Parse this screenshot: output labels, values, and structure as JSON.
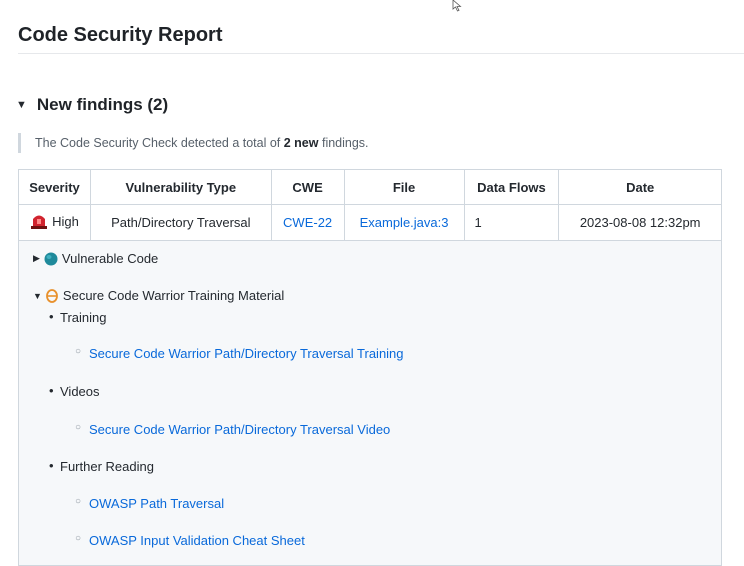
{
  "report": {
    "title": "Code Security Report",
    "section_title": "New findings (2)",
    "summary": {
      "prefix": "The Code Security Check detected a total of ",
      "count": "2 new",
      "suffix": " findings."
    }
  },
  "table": {
    "headers": [
      "Severity",
      "Vulnerability Type",
      "CWE",
      "File",
      "Data Flows",
      "Date"
    ],
    "rows": [
      {
        "severity": "High",
        "severity_icon": "siren-icon",
        "type": "Path/Directory Traversal",
        "cwe": "CWE-22",
        "file": "Example.java:3",
        "data_flows": "1",
        "date": "2023-08-08 12:32pm"
      }
    ]
  },
  "details": {
    "vulnerable_code_label": "Vulnerable Code",
    "training_material_label": "Secure Code Warrior Training Material",
    "groups": [
      {
        "label": "Training",
        "links": [
          "Secure Code Warrior Path/Directory Traversal Training"
        ]
      },
      {
        "label": "Videos",
        "links": [
          "Secure Code Warrior Path/Directory Traversal Video"
        ]
      },
      {
        "label": "Further Reading",
        "links": [
          "OWASP Path Traversal",
          "OWASP Input Validation Cheat Sheet"
        ]
      }
    ]
  },
  "colors": {
    "link": "#0969da",
    "siren": "#d1242f",
    "globe": "#1f8a9b",
    "scw": "#e8912d"
  }
}
